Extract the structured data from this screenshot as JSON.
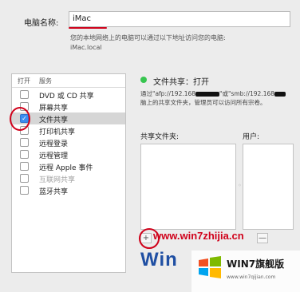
{
  "computer_name": {
    "label": "电脑名称:",
    "value": "iMac",
    "hint_line1": "您的本地网络上的电脑可以通过以下地址访问您的电脑:",
    "hint_line2": "iMac.local"
  },
  "services": {
    "header_on": "打开",
    "header_service": "服务",
    "items": [
      {
        "label": "DVD 或 CD 共享",
        "checked": false,
        "enabled": true
      },
      {
        "label": "屏幕共享",
        "checked": false,
        "enabled": true
      },
      {
        "label": "文件共享",
        "checked": true,
        "enabled": true
      },
      {
        "label": "打印机共享",
        "checked": false,
        "enabled": true
      },
      {
        "label": "远程登录",
        "checked": false,
        "enabled": true
      },
      {
        "label": "远程管理",
        "checked": false,
        "enabled": true
      },
      {
        "label": "远程 Apple 事件",
        "checked": false,
        "enabled": true
      },
      {
        "label": "互联网共享",
        "checked": false,
        "enabled": false
      },
      {
        "label": "蓝牙共享",
        "checked": false,
        "enabled": true
      }
    ]
  },
  "status": {
    "text": "文件共享：打开",
    "desc_a": "通过\"afp://192.168",
    "desc_b": "\"或\"smb://192.168",
    "desc_line2": "脑上的共享文件夹，管理员可以访问所有宗卷。",
    "color": "#37c54f"
  },
  "panes": {
    "shared_folders_label": "共享文件夹:",
    "users_label": "用户:",
    "add_symbol": "+",
    "remove_symbol": "—"
  },
  "watermark": {
    "url": "www.win7zhijia.cn",
    "brand": "Win",
    "logo_title": "WIN7旗舰版",
    "logo_url": "www.win7qijian.com"
  },
  "icons": [
    "check-icon",
    "status-dot-icon",
    "windows-logo-icon"
  ]
}
